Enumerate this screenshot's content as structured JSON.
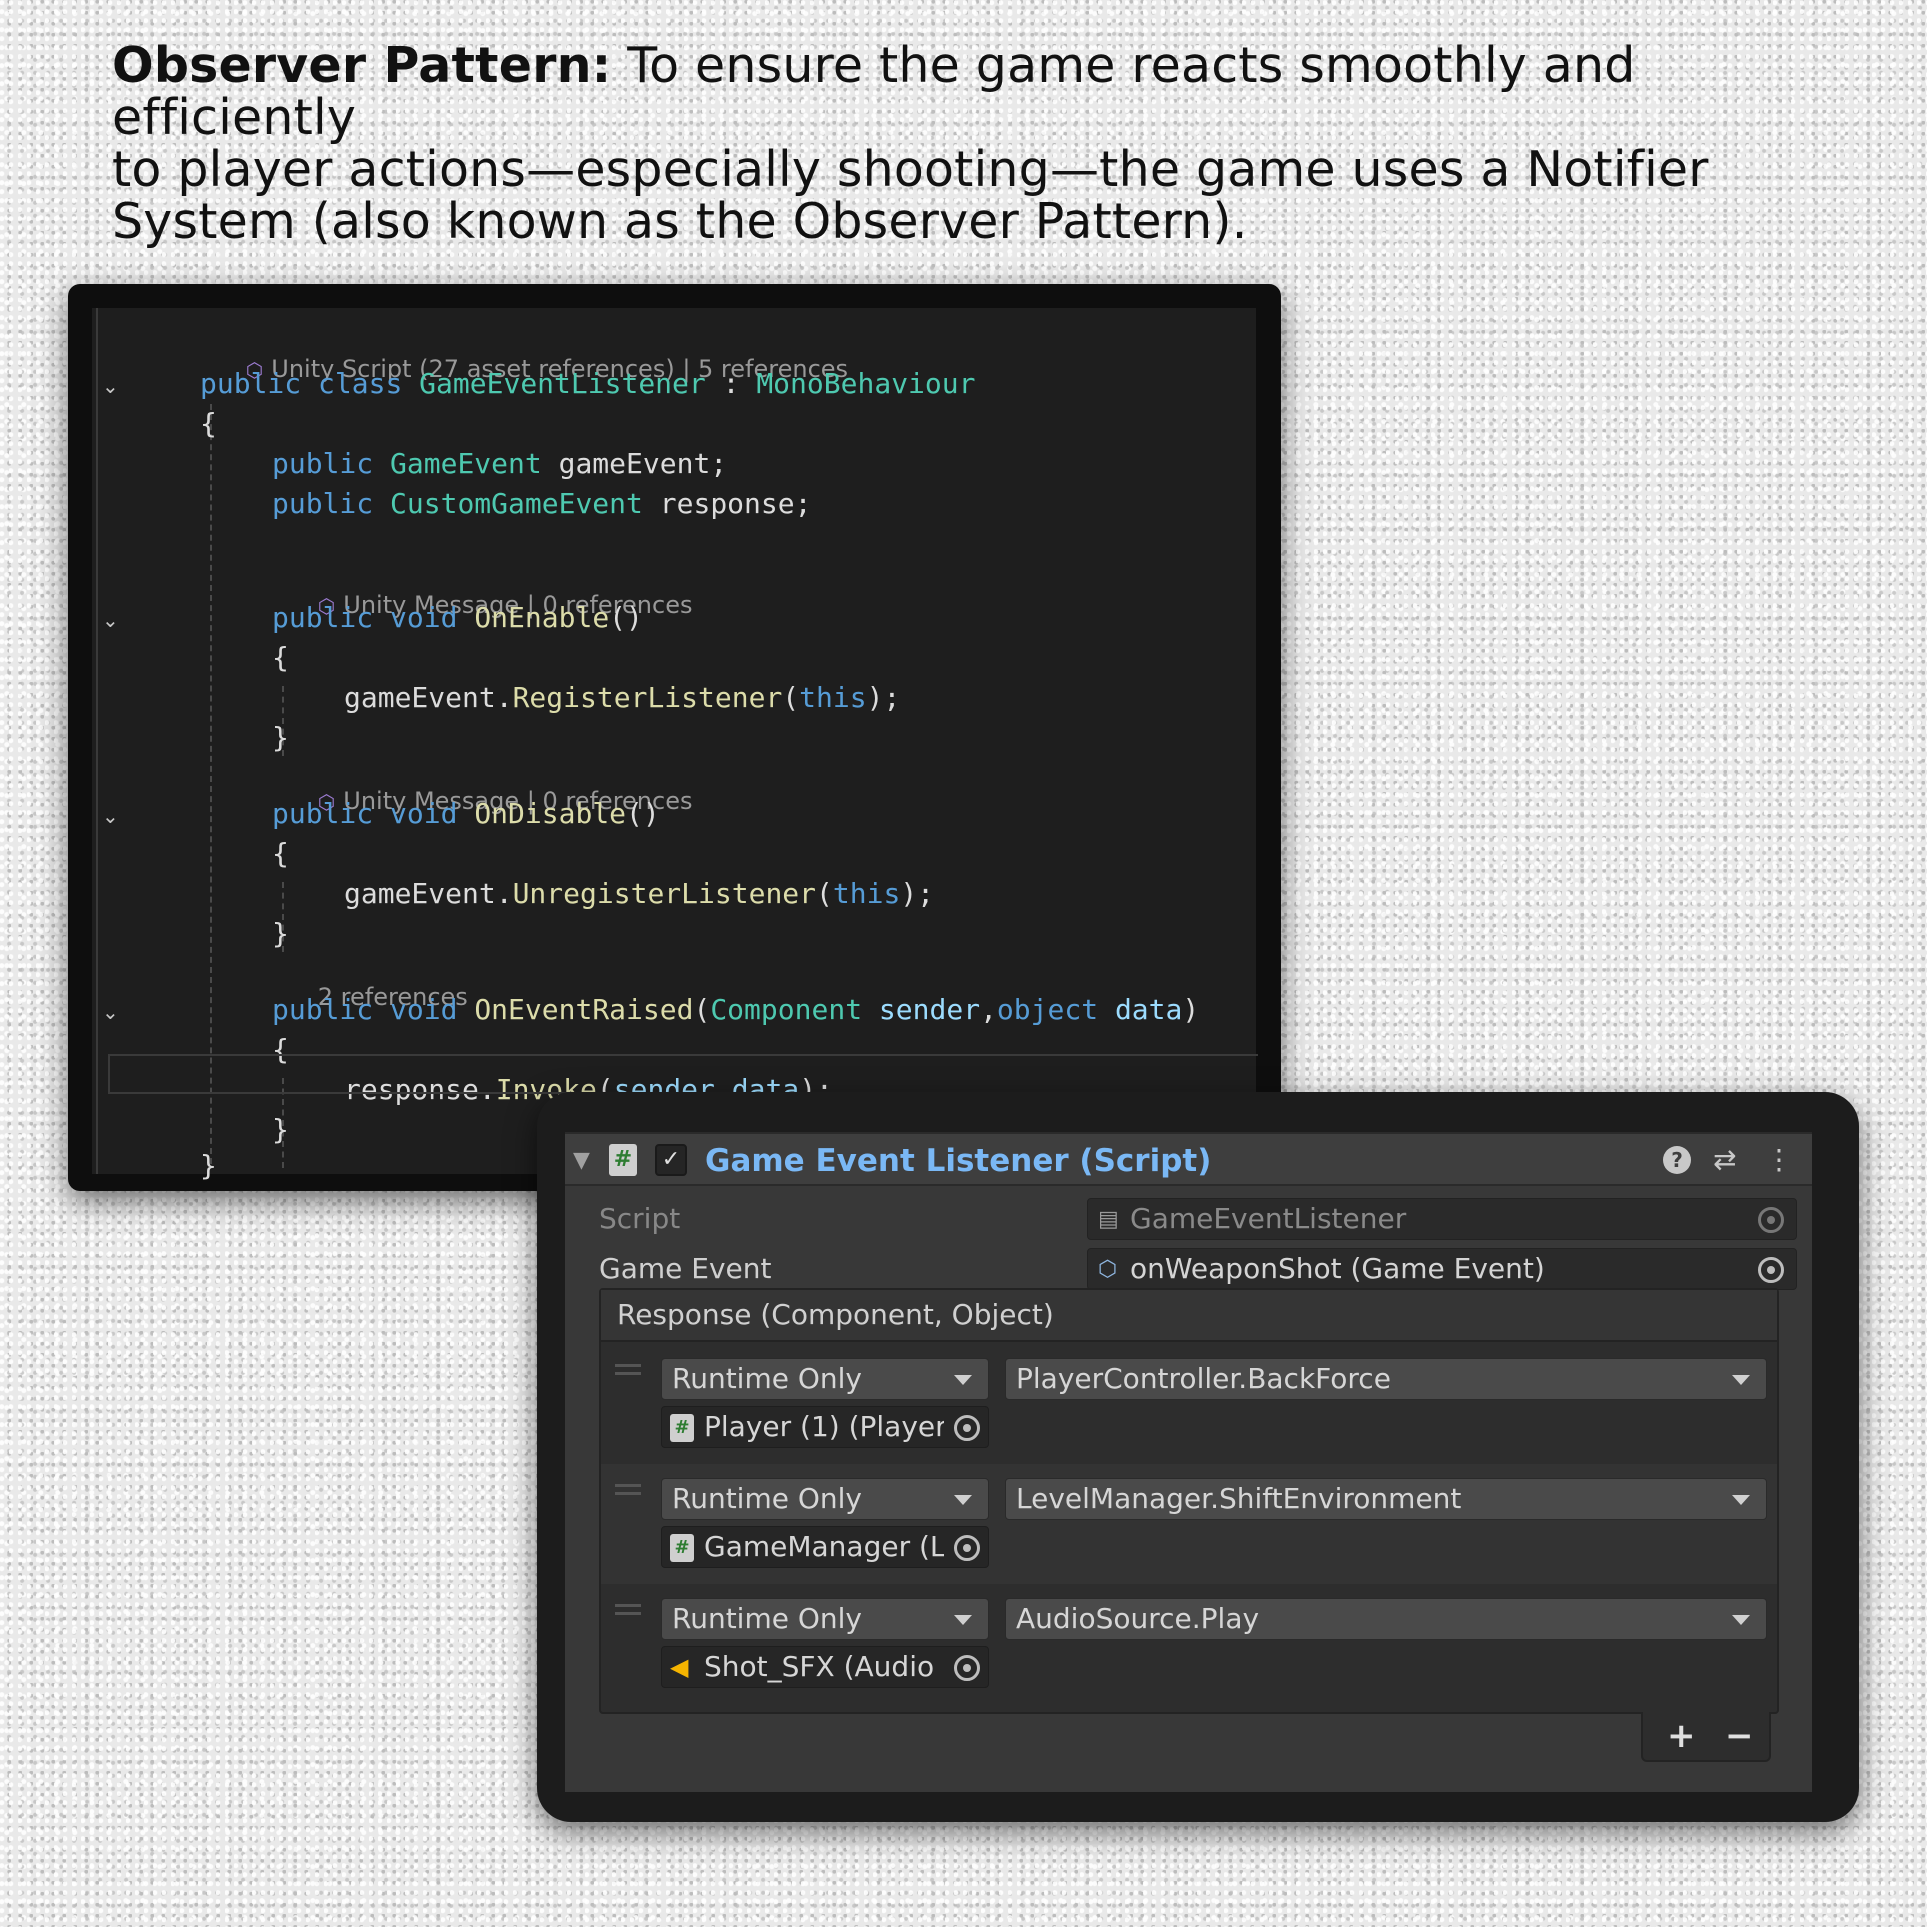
{
  "intro": {
    "heading": "Observer Pattern:",
    "line1": " To ensure the game reacts smoothly and efficiently",
    "line2": "to player actions—especially shooting—the game uses a Notifier",
    "line3": "System (also known as the Observer Pattern)."
  },
  "code": {
    "lens_class": "Unity Script (27 asset references) | 5 references",
    "lens_enable": "Unity Message | 0 references",
    "lens_disable": "Unity Message | 0 references",
    "lens_raised": "2 references",
    "kw_public": "public",
    "kw_class": "class",
    "kw_void": "void",
    "kw_this": "this",
    "kw_object": "object",
    "class_name": "GameEventListener",
    "colon": " : ",
    "base_class": "MonoBehaviour",
    "open_brace": "{",
    "close_brace": "}",
    "type_gameevent": "GameEvent",
    "field_gameevent": " gameEvent;",
    "type_customevent": "CustomGameEvent",
    "field_response": " response;",
    "fn_onenable": "OnEnable",
    "fn_ondisable": "OnDisable",
    "fn_onraised": "OnEventRaised",
    "parens": "()",
    "obj_gameevent": "gameEvent",
    "dot": ".",
    "fn_register": "RegisterListener",
    "fn_unregister": "UnregisterListener",
    "open_paren": "(",
    "close_call": ");",
    "type_component": "Component",
    "param_sender": "sender",
    "comma": ",",
    "param_data": "data",
    "close_paren": ")",
    "obj_response": "response",
    "fn_invoke": "Invoke"
  },
  "inspector": {
    "component_title": "Game Event Listener (Script)",
    "checkbox_glyph": "✓",
    "hash_glyph": "#",
    "help_glyph": "?",
    "script_label": "Script",
    "script_value": "GameEventListener",
    "game_event_label": "Game Event",
    "game_event_value": "onWeaponShot (Game Event)",
    "response_label": "Response (Component, Object)",
    "listeners": [
      {
        "mode": "Runtime Only",
        "function": "PlayerController.BackForce",
        "target": "Player (1) (Player"
      },
      {
        "mode": "Runtime Only",
        "function": "LevelManager.ShiftEnvironment",
        "target": "GameManager (L"
      },
      {
        "mode": "Runtime Only",
        "function": "AudioSource.Play",
        "target": "Shot_SFX (Audio"
      }
    ],
    "add_label": "+",
    "remove_label": "−"
  },
  "colors": {
    "keyword": "#569cd6",
    "type": "#4ec9b0",
    "function": "#dcdcaa",
    "parameter": "#9cdcfe",
    "component_title": "#7ab8f5",
    "audio_icon": "#f5b400"
  }
}
